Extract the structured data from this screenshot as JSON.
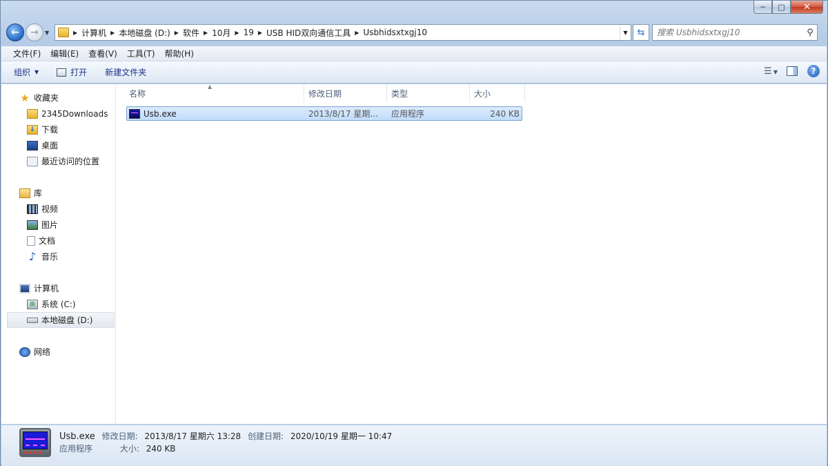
{
  "window": {
    "caption": {
      "minimize": "─",
      "maximize": "□",
      "close": "✕"
    }
  },
  "address": {
    "crumbs": [
      "计算机",
      "本地磁盘 (D:)",
      "软件",
      "10月",
      "19",
      "USB HID双向通信工具",
      "Usbhidsxtxgj10"
    ]
  },
  "search": {
    "placeholder": "搜索 Usbhidsxtxgj10"
  },
  "menubar": [
    "文件(F)",
    "编辑(E)",
    "查看(V)",
    "工具(T)",
    "帮助(H)"
  ],
  "toolbar": {
    "organize": "组织",
    "open": "打开",
    "new_folder": "新建文件夹"
  },
  "nav": {
    "favorites": {
      "label": "收藏夹",
      "items": [
        "2345Downloads",
        "下载",
        "桌面",
        "最近访问的位置"
      ]
    },
    "libraries": {
      "label": "库",
      "items": [
        "视频",
        "图片",
        "文档",
        "音乐"
      ]
    },
    "computer": {
      "label": "计算机",
      "items": [
        "系统 (C:)",
        "本地磁盘 (D:)"
      ]
    },
    "network": {
      "label": "网络"
    }
  },
  "columns": {
    "name": "名称",
    "modified": "修改日期",
    "type": "类型",
    "size": "大小"
  },
  "files": [
    {
      "name": "Usb.exe",
      "modified": "2013/8/17 星期...",
      "type": "应用程序",
      "size": "240 KB"
    }
  ],
  "details": {
    "name": "Usb.exe",
    "modified_label": "修改日期:",
    "modified": "2013/8/17 星期六 13:28",
    "created_label": "创建日期:",
    "created": "2020/10/19 星期一 10:47",
    "type": "应用程序",
    "size_label": "大小:",
    "size": "240 KB"
  },
  "icons": {
    "back": "back-arrow-icon",
    "forward": "forward-arrow-icon",
    "search": "magnifier-icon",
    "help": "help-icon",
    "favorites": "star-icon"
  },
  "colors": {
    "selection": "#c1dcfb",
    "command_text": "#1e3287",
    "close_button": "#c03a20"
  }
}
